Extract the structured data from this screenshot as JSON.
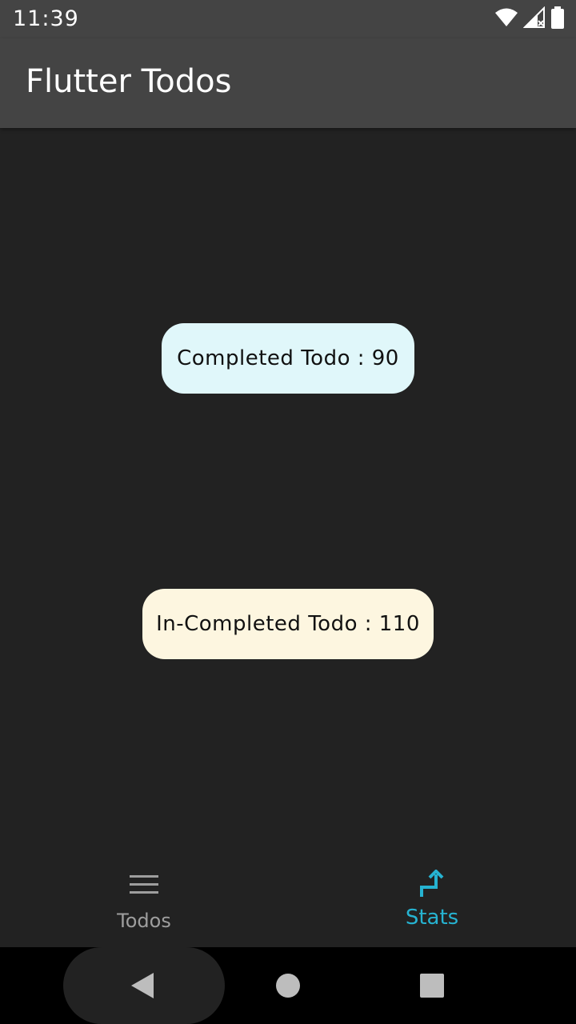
{
  "status_bar": {
    "time": "11:39",
    "icons": [
      "wifi-icon",
      "cell-signal-icon",
      "battery-icon"
    ]
  },
  "app_bar": {
    "title": "Flutter Todos"
  },
  "stats": {
    "completed_label": "Completed Todo : 90",
    "incompleted_label": "In-Completed Todo : 110"
  },
  "bottom_nav": {
    "items": [
      {
        "label": "Todos",
        "icon": "list-icon",
        "active": false
      },
      {
        "label": "Stats",
        "icon": "stats-icon",
        "active": true
      }
    ]
  },
  "system_nav": {
    "icons": [
      "back-icon",
      "home-icon",
      "recents-icon"
    ]
  },
  "colors": {
    "app_bar": "#444444",
    "background": "#222222",
    "accent": "#26b3d1",
    "completed_pill": "#e0f7fa",
    "incompleted_pill": "#fdf6e0"
  }
}
